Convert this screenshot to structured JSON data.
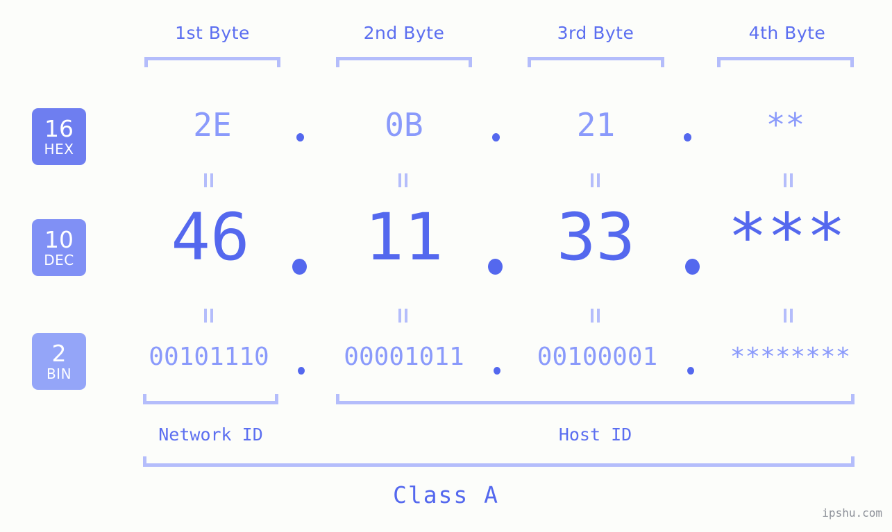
{
  "page": {
    "background_color": "#fcfdfa",
    "accent_color": "#5468ee",
    "accent_light_color": "#8a9afb",
    "bracket_color": "#b4bdfb",
    "watermark": "ipshu.com"
  },
  "header": {
    "byte_columns": [
      {
        "label": "1st Byte"
      },
      {
        "label": "2nd Byte"
      },
      {
        "label": "3rd Byte"
      },
      {
        "label": "4th Byte"
      }
    ]
  },
  "bases": [
    {
      "number": "16",
      "name": "HEX",
      "color": "#6e7ef0"
    },
    {
      "number": "10",
      "name": "DEC",
      "color": "#8090f5"
    },
    {
      "number": "2",
      "name": "BIN",
      "color": "#94a5f8"
    }
  ],
  "rows": {
    "hex": {
      "base_number": "16",
      "base_name": "HEX",
      "octets": [
        "2E",
        "0B",
        "21",
        "**"
      ],
      "separator": "."
    },
    "dec": {
      "base_number": "10",
      "base_name": "DEC",
      "octets": [
        "46",
        "11",
        "33",
        "***"
      ],
      "separator": "."
    },
    "bin": {
      "base_number": "2",
      "base_name": "BIN",
      "octets": [
        "00101110",
        "00001011",
        "00100001",
        "********"
      ],
      "separator": "."
    }
  },
  "equals_marks": {
    "symbol": "=",
    "count_per_row": 4
  },
  "footer": {
    "network_id_label": "Network ID",
    "host_id_label": "Host ID",
    "class_label": "Class A"
  }
}
